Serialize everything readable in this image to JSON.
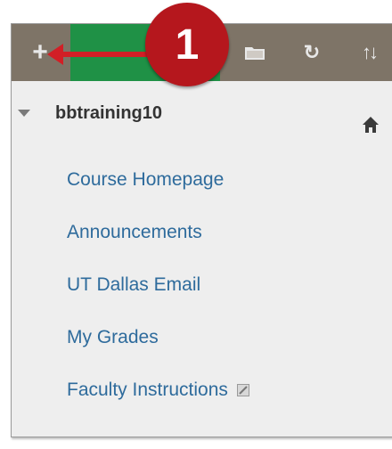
{
  "toolbar": {
    "add_icon": "plus-icon",
    "add_symbol": "+",
    "step_number": "1",
    "folder_icon": "folder-icon",
    "refresh_icon": "refresh-icon",
    "refresh_symbol": "↻",
    "sort_icon": "sort-icon",
    "sort_symbol": "↑↓",
    "bar_color": "#7e7467",
    "highlight_color": "#1f9146",
    "callout_color": "#b5171d"
  },
  "course": {
    "title": "bbtraining10",
    "home_icon": "home-icon"
  },
  "menu": {
    "items": [
      {
        "label": "Course Homepage"
      },
      {
        "label": "Announcements"
      },
      {
        "label": "UT Dallas Email"
      },
      {
        "label": "My Grades"
      },
      {
        "label": "Faculty Instructions",
        "icon": "external-link-icon"
      }
    ],
    "link_color": "#2e6b9c"
  }
}
